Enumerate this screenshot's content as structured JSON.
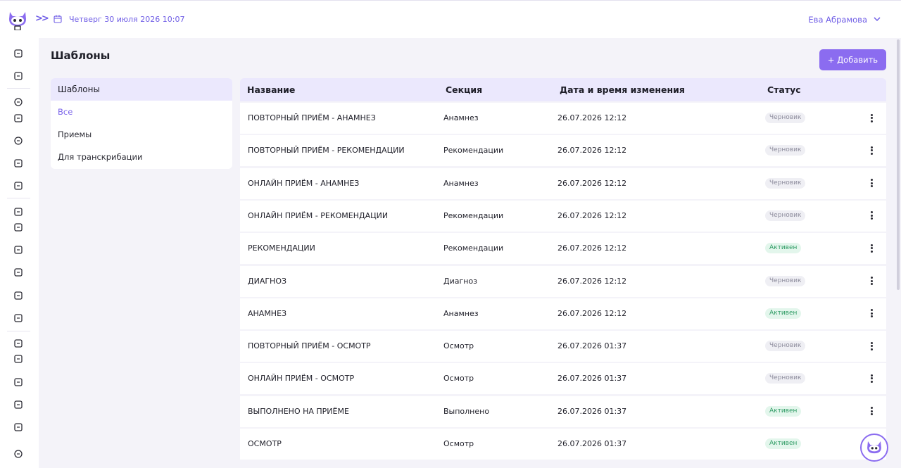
{
  "header": {
    "datetime": "Четверг 30 июля 2026 10:07",
    "user_name": "Ева Абрамова"
  },
  "page": {
    "title": "Шаблоны",
    "add_label": "+ Добавить"
  },
  "filter": {
    "title": "Шаблоны",
    "items": [
      "Все",
      "Приемы",
      "Для транскрибации"
    ]
  },
  "table": {
    "columns": [
      "Название",
      "Секция",
      "Дата и время изменения",
      "Статус"
    ],
    "rows": [
      {
        "name": "ПОВТОРНЫЙ ПРИЁМ - АНАМНЕЗ",
        "section": "Анамнез",
        "date": "26.07.2026 12:12",
        "status": "Черновик",
        "kind": "draft"
      },
      {
        "name": "ПОВТОРНЫЙ ПРИЁМ - РЕКОМЕНДАЦИИ",
        "section": "Рекомендации",
        "date": "26.07.2026 12:12",
        "status": "Черновик",
        "kind": "draft"
      },
      {
        "name": "ОНЛАЙН ПРИЁМ - АНАМНЕЗ",
        "section": "Анамнез",
        "date": "26.07.2026 12:12",
        "status": "Черновик",
        "kind": "draft"
      },
      {
        "name": "ОНЛАЙН ПРИЁМ - РЕКОМЕНДАЦИИ",
        "section": "Рекомендации",
        "date": "26.07.2026 12:12",
        "status": "Черновик",
        "kind": "draft"
      },
      {
        "name": "РЕКОМЕНДАЦИИ",
        "section": "Рекомендации",
        "date": "26.07.2026 12:12",
        "status": "Активен",
        "kind": "active"
      },
      {
        "name": "ДИАГНОЗ",
        "section": "Диагноз",
        "date": "26.07.2026 12:12",
        "status": "Черновик",
        "kind": "draft"
      },
      {
        "name": "АНАМНЕЗ",
        "section": "Анамнез",
        "date": "26.07.2026 12:12",
        "status": "Активен",
        "kind": "active"
      },
      {
        "name": "ПОВТОРНЫЙ ПРИЁМ - ОСМОТР",
        "section": "Осмотр",
        "date": "26.07.2026 01:37",
        "status": "Черновик",
        "kind": "draft"
      },
      {
        "name": "ОНЛАЙН ПРИЁМ - ОСМОТР",
        "section": "Осмотр",
        "date": "26.07.2026 01:37",
        "status": "Черновик",
        "kind": "draft"
      },
      {
        "name": "ВЫПОЛНЕНО НА ПРИЁМЕ",
        "section": "Выполнено",
        "date": "26.07.2026 01:37",
        "status": "Активен",
        "kind": "active"
      },
      {
        "name": "ОСМОТР",
        "section": "Осмотр",
        "date": "26.07.2026 01:37",
        "status": "Активен",
        "kind": "active"
      }
    ]
  },
  "rail_icons": [
    "clipboard-search-icon",
    "archive-icon",
    "inbox-icon",
    "phone-icon",
    "document-icon",
    "phone-icon",
    "clipboard-icon",
    "mail-icon",
    "bar-chart-icon",
    "pie-chart-icon",
    "line-chart-icon",
    "file-icon",
    "building-chart-icon",
    "document-check-icon",
    "settings-square-icon",
    "users-icon",
    "calendar-icon",
    "bag-icon",
    "briefcase-icon",
    "gear-icon"
  ],
  "colors": {
    "accent": "#8b6cf0",
    "header_bg": "#ebe8fd",
    "draft_text": "#8d8c9c",
    "active_text": "#2c9a62"
  }
}
